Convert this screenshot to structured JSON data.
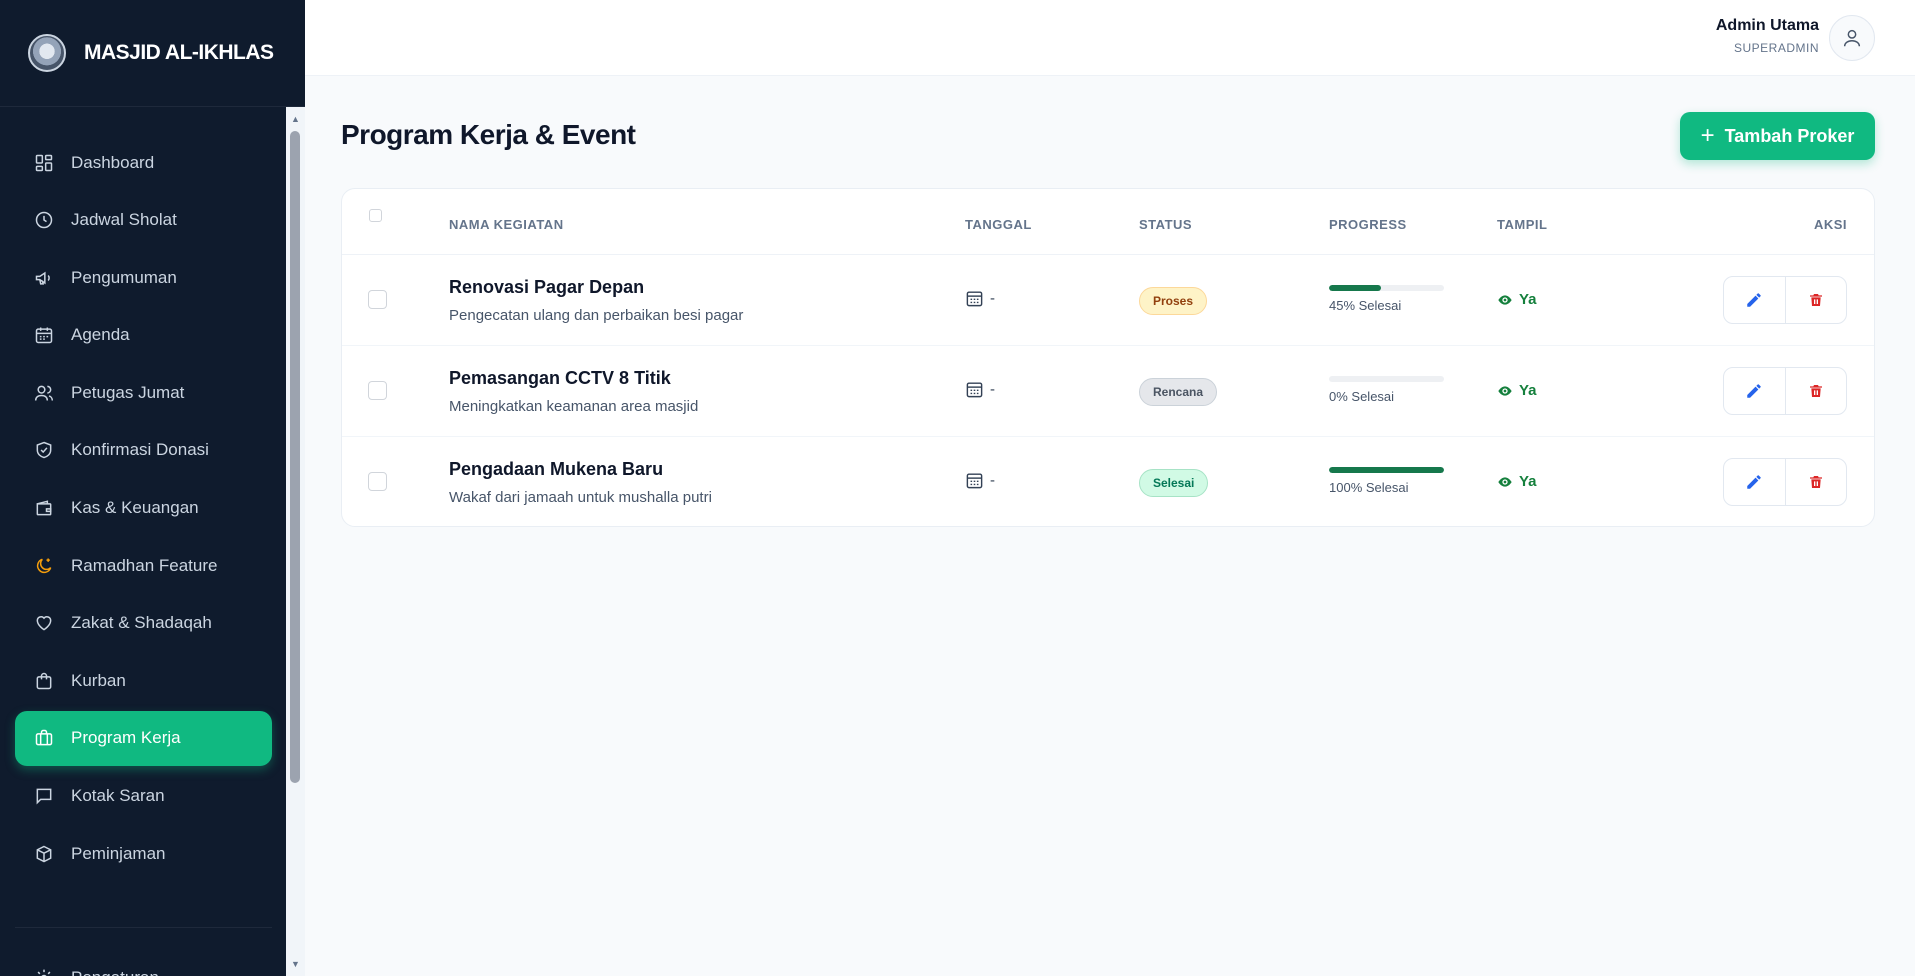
{
  "brand": {
    "name": "MASJID AL-IKHLAS"
  },
  "sidebar": {
    "items": [
      {
        "label": "Dashboard",
        "icon": "dashboard-icon"
      },
      {
        "label": "Jadwal Sholat",
        "icon": "clock-icon"
      },
      {
        "label": "Pengumuman",
        "icon": "megaphone-icon"
      },
      {
        "label": "Agenda",
        "icon": "calendar-icon"
      },
      {
        "label": "Petugas Jumat",
        "icon": "users-icon"
      },
      {
        "label": "Konfirmasi Donasi",
        "icon": "shield-check-icon"
      },
      {
        "label": "Kas & Keuangan",
        "icon": "wallet-icon"
      },
      {
        "label": "Ramadhan Feature",
        "icon": "moon-icon"
      },
      {
        "label": "Zakat & Shadaqah",
        "icon": "heart-icon"
      },
      {
        "label": "Kurban",
        "icon": "bag-icon"
      },
      {
        "label": "Program Kerja",
        "icon": "briefcase-icon",
        "active": true
      },
      {
        "label": "Kotak Saran",
        "icon": "message-icon"
      },
      {
        "label": "Peminjaman",
        "icon": "box-icon"
      }
    ],
    "settings_label": "Pengaturan"
  },
  "header": {
    "user_name": "Admin Utama",
    "user_role": "SUPERADMIN"
  },
  "main": {
    "title": "Program Kerja & Event",
    "add_button": "Tambah Proker",
    "table": {
      "columns": {
        "name": "NAMA KEGIATAN",
        "date": "TANGGAL",
        "status": "STATUS",
        "progress": "PROGRESS",
        "visible": "TAMPIL",
        "actions": "AKSI"
      },
      "rows": [
        {
          "title": "Renovasi Pagar Depan",
          "desc": "Pengecatan ulang dan perbaikan besi pagar",
          "date": "-",
          "status": "Proses",
          "progress_value": 45,
          "progress_text": "45% Selesai",
          "visible": "Ya"
        },
        {
          "title": "Pemasangan CCTV 8 Titik",
          "desc": "Meningkatkan keamanan area masjid",
          "date": "-",
          "status": "Rencana",
          "progress_value": 0,
          "progress_text": "0% Selesai",
          "visible": "Ya"
        },
        {
          "title": "Pengadaan Mukena Baru",
          "desc": "Wakaf dari jamaah untuk mushalla putri",
          "date": "-",
          "status": "Selesai",
          "progress_value": 100,
          "progress_text": "100% Selesai",
          "visible": "Ya"
        }
      ]
    }
  },
  "colors": {
    "sidebar_bg": "#0f1b2d",
    "accent": "#10b981",
    "progress": "#16784c",
    "edit_icon": "#2563eb",
    "delete_icon": "#dc2626",
    "visible": "#15803d",
    "ramadhan_icon": "#f59e0b"
  }
}
